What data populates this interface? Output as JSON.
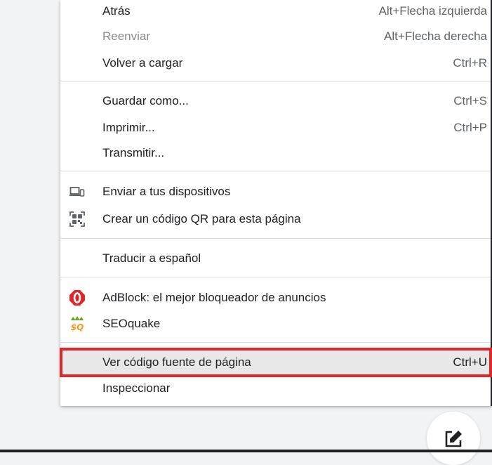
{
  "menu": {
    "navigation": [
      {
        "label": "Atrás",
        "shortcut": "Alt+Flecha izquierda"
      },
      {
        "label": "Reenviar",
        "shortcut": "Alt+Flecha derecha"
      },
      {
        "label": "Volver a cargar",
        "shortcut": "Ctrl+R"
      }
    ],
    "page": [
      {
        "label": "Guardar como...",
        "shortcut": "Ctrl+S"
      },
      {
        "label": "Imprimir...",
        "shortcut": "Ctrl+P"
      },
      {
        "label": "Transmitir..."
      }
    ],
    "share": [
      {
        "label": "Enviar a tus dispositivos",
        "icon": "devices-icon"
      },
      {
        "label": "Crear un código QR para esta página",
        "icon": "qr-code-icon"
      }
    ],
    "translate": {
      "label": "Traducir a español"
    },
    "extensions": [
      {
        "label": "AdBlock: el mejor bloqueador de anuncios",
        "icon": "adblock-icon"
      },
      {
        "label": "SEOquake",
        "icon": "seoquake-icon"
      }
    ],
    "developer": [
      {
        "label": "Ver código fuente de página",
        "shortcut": "Ctrl+U"
      },
      {
        "label": "Inspeccionar"
      }
    ]
  },
  "colors": {
    "highlight_border": "#e0262b",
    "disabled_text": "#8a8a8a",
    "adblock_red": "#e0262b",
    "seoquake_green": "#6aa121",
    "seoquake_orange": "#f39a1e"
  },
  "fab": {
    "icon": "edit-icon"
  }
}
